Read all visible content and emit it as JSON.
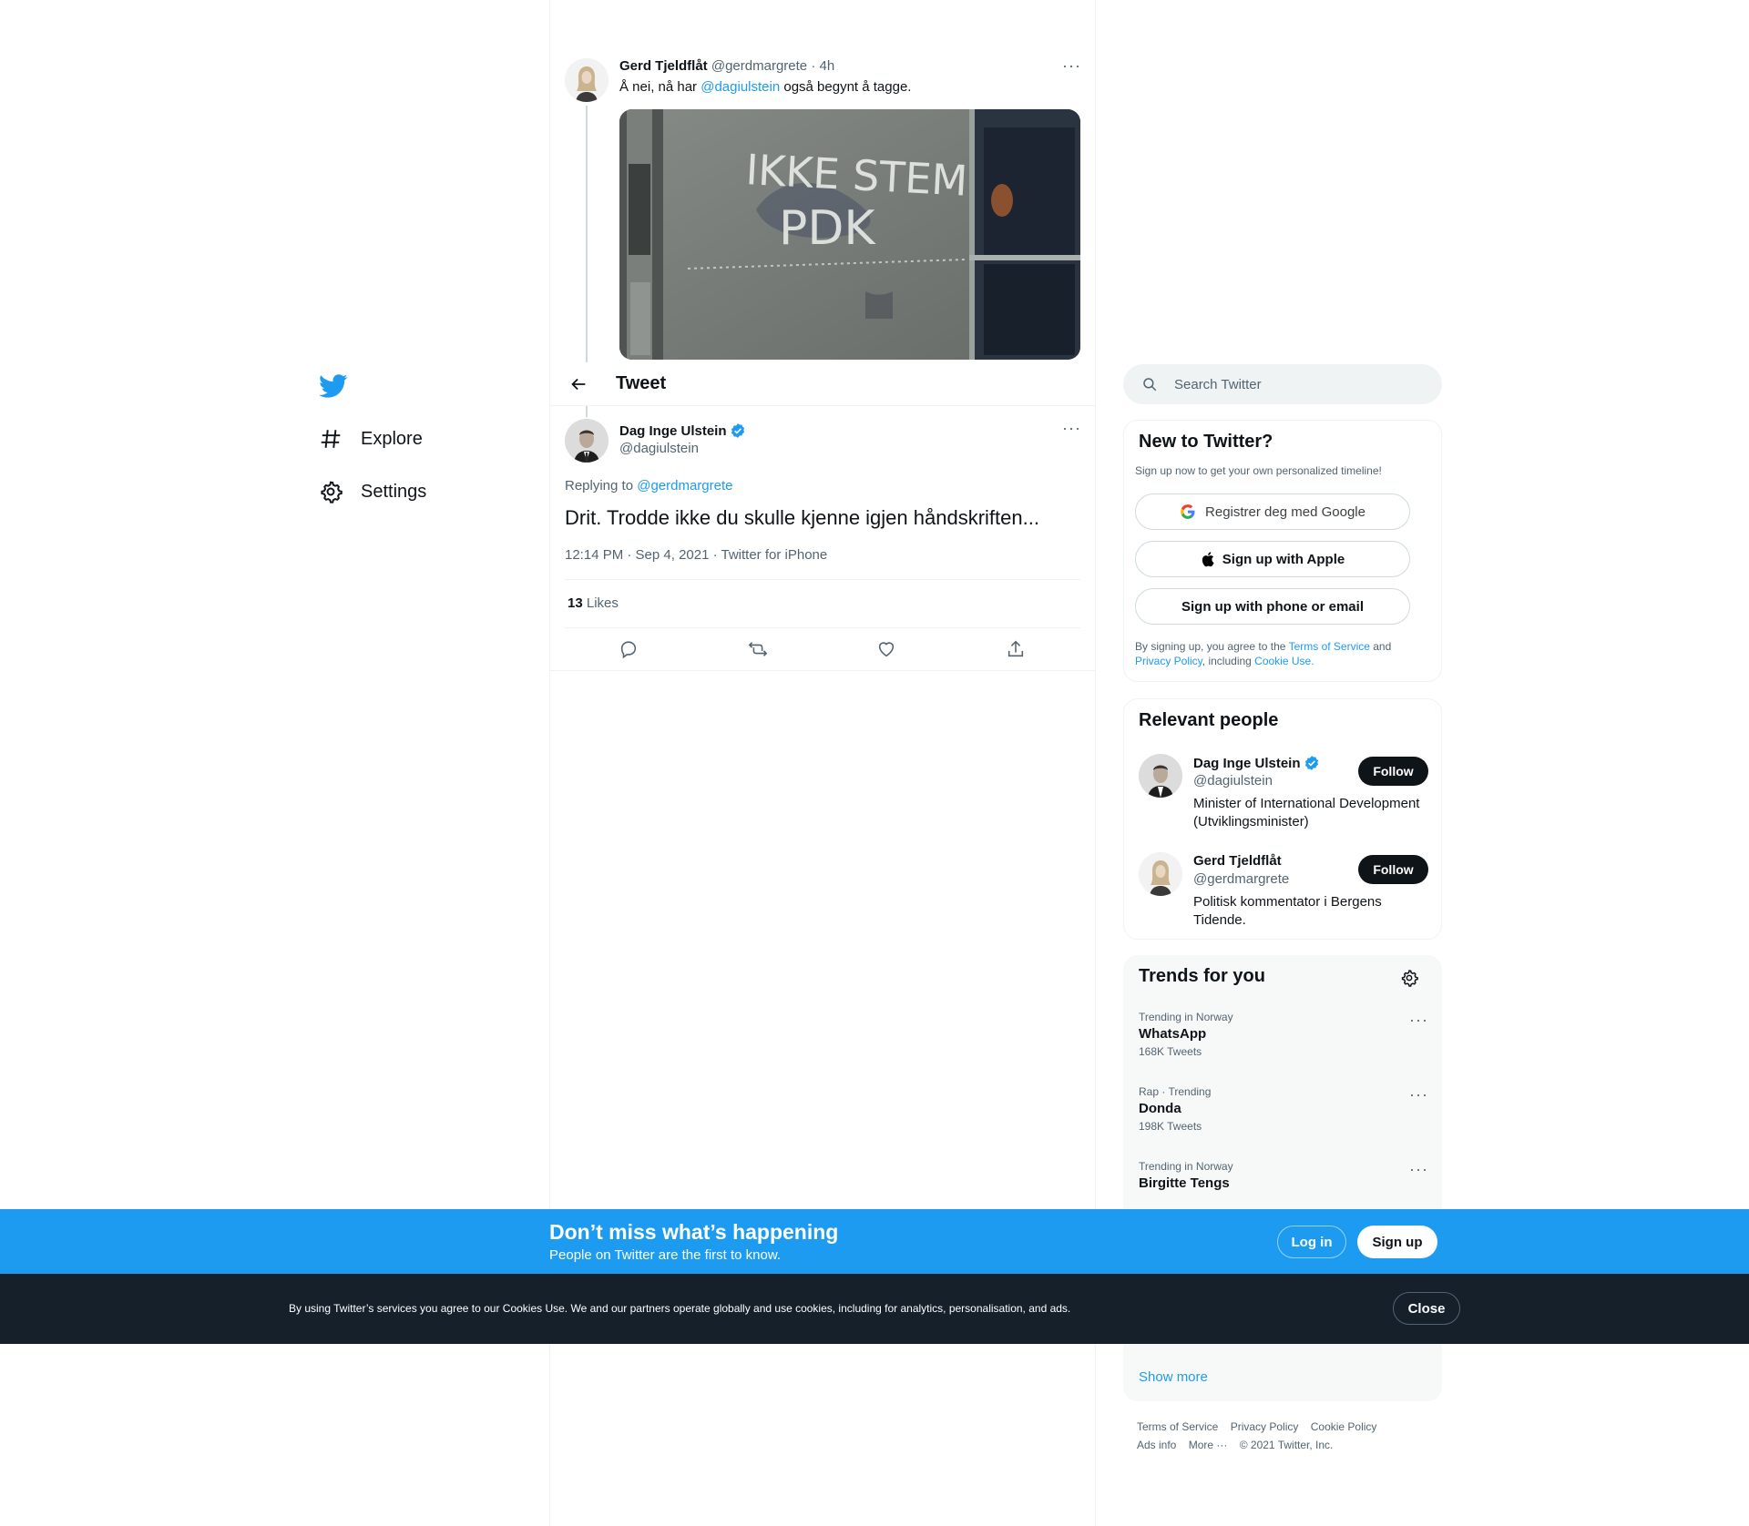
{
  "nav": {
    "explore": "Explore",
    "settings": "Settings"
  },
  "parent_tweet": {
    "name": "Gerd Tjeldflåt",
    "handle": "@gerdmargrete",
    "time": "· 4h",
    "text_before": "Å nei, nå har ",
    "mention": "@dagiulstein",
    "text_after": " også begynt å tagge.",
    "photo_text_line1": "IKKE STEM",
    "photo_text_line2": "PDK"
  },
  "header": {
    "title": "Tweet"
  },
  "main_tweet": {
    "name": "Dag Inge Ulstein",
    "handle": "@dagiulstein",
    "replying_label": "Replying to ",
    "replying_to": "@gerdmargrete",
    "text": "Drit. Trodde ikke du skulle kjenne igjen håndskriften...",
    "meta": "12:14 PM · Sep 4, 2021 · Twitter for iPhone",
    "likes_count": "13",
    "likes_label": "Likes"
  },
  "search": {
    "placeholder": "Search Twitter"
  },
  "new_to_twitter": {
    "title": "New to Twitter?",
    "subtitle": "Sign up now to get your own personalized timeline!",
    "google_btn": "Registrer deg med Google",
    "apple_btn": "Sign up with Apple",
    "phone_btn": "Sign up with phone or email",
    "legal_1": "By signing up, you agree to the ",
    "terms": "Terms of Service",
    "legal_2": " and",
    "privacy": "Privacy Policy",
    "legal_3": ", including ",
    "cookie": "Cookie Use."
  },
  "relevant_people": {
    "title": "Relevant people",
    "people": [
      {
        "name": "Dag Inge Ulstein",
        "handle": "@dagiulstein",
        "bio": "Minister of International Development (Utviklingsminister)",
        "follow": "Follow"
      },
      {
        "name": "Gerd Tjeldflåt",
        "handle": "@gerdmargrete",
        "bio": "Politisk kommentator i Bergens Tidende.",
        "follow": "Follow"
      }
    ]
  },
  "trends": {
    "title": "Trends for you",
    "items": [
      {
        "context": "Trending in Norway",
        "name": "WhatsApp",
        "count": "168K Tweets"
      },
      {
        "context": "Rap · Trending",
        "name": "Donda",
        "count": "198K Tweets"
      },
      {
        "context": "Trending in Norway",
        "name": "Birgitte Tengs",
        "count": ""
      }
    ],
    "show_more": "Show more"
  },
  "footer": {
    "terms": "Terms of Service",
    "privacy": "Privacy Policy",
    "cookie": "Cookie Policy",
    "ads": "Ads info",
    "more": "More ···",
    "copyright": "© 2021 Twitter, Inc."
  },
  "blue_banner": {
    "title": "Don’t miss what’s happening",
    "subtitle": "People on Twitter are the first to know.",
    "login": "Log in",
    "signup": "Sign up"
  },
  "cookie_banner": {
    "text": "By using Twitter’s services you agree to our Cookies Use. We and our partners operate globally and use cookies, including for analytics, personalisation, and ads.",
    "close": "Close"
  },
  "colors": {
    "brand": "#1d9bf0",
    "dark": "#0f1419",
    "muted": "#536471"
  }
}
